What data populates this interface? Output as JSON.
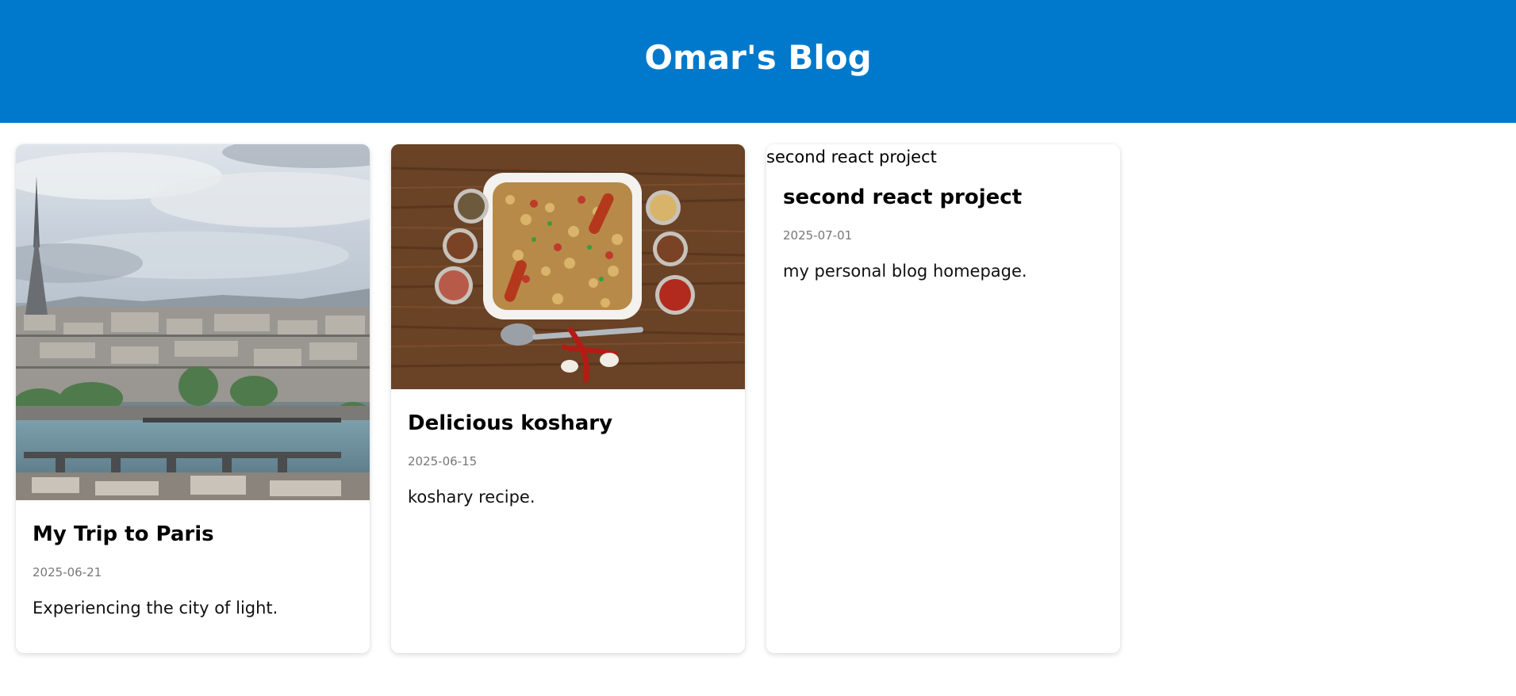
{
  "header": {
    "title": "Omar's Blog",
    "background": "#0079cc"
  },
  "posts": [
    {
      "title": "My Trip to Paris",
      "date": "2025-06-21",
      "description": "Experiencing the city of light.",
      "image": "paris-cityscape-photo"
    },
    {
      "title": "Delicious koshary",
      "date": "2025-06-15",
      "description": "koshary recipe.",
      "image": "koshary-dish-photo"
    },
    {
      "title": "second react project",
      "date": "2025-07-01",
      "description": "my personal blog homepage.",
      "image_alt": "second react project"
    }
  ]
}
